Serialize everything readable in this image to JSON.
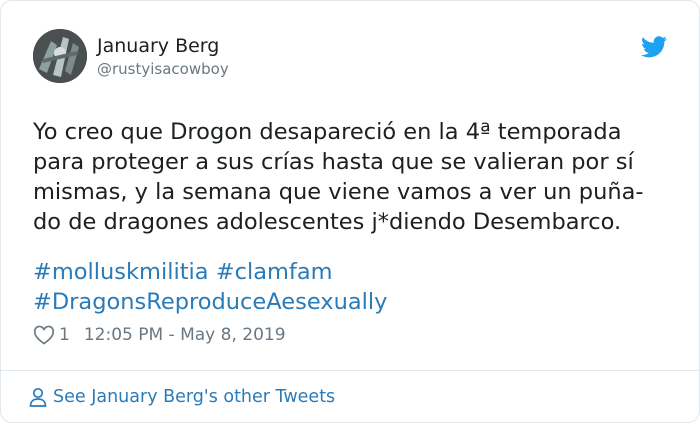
{
  "tweet": {
    "author": {
      "name": "January Berg",
      "handle": "@rustyisacowboy",
      "avatar": "avatar-photo"
    },
    "brand_icon": "twitter-bird-icon",
    "accent_color": "#2b7bb9",
    "text_lines": [
      "Yo creo que Drogon desapareció en la 4ª temporada",
      "para proteger a sus crías hasta que se valieran por sí",
      "mismas, y la semana que viene vamos a ver un puña-",
      "do de dragones adolescentes j*diendo Desembarco."
    ],
    "hashtags_line1": [
      "#molluskmilitia",
      "#clamfam"
    ],
    "hashtags_line2": [
      "#DragonsReproduceAesexually"
    ],
    "likes": "1",
    "timestamp": "12:05 PM - May 8, 2019",
    "footer_link": "See January Berg's other Tweets"
  }
}
